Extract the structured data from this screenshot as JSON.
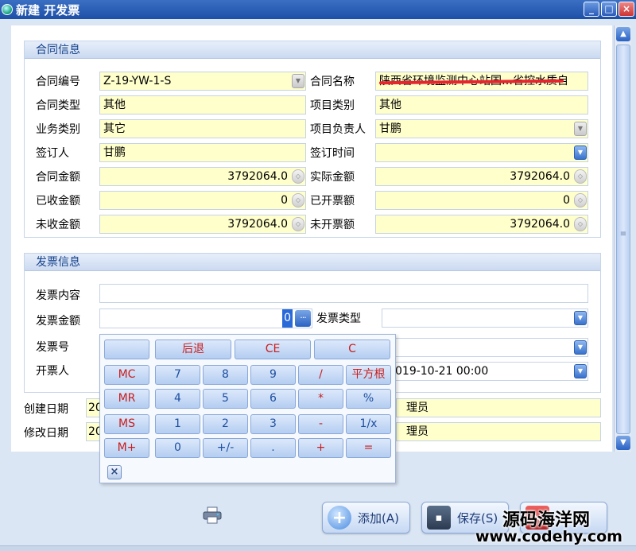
{
  "window": {
    "title": "新建 开发票",
    "min": "_",
    "max": "□",
    "close": "×"
  },
  "contract": {
    "section": "合同信息",
    "contract_no_label": "合同编号",
    "contract_no": "Z-19-YW-1-S",
    "contract_name_label": "合同名称",
    "contract_name": "陕西省环境监测中心站国…省控水质自",
    "contract_type_label": "合同类型",
    "contract_type": "其他",
    "project_type_label": "项目类别",
    "project_type": "其他",
    "business_type_label": "业务类别",
    "business_type": "其它",
    "project_lead_label": "项目负责人",
    "project_lead": "甘鹏",
    "signer_label": "签订人",
    "signer": "甘鹏",
    "sign_time_label": "签订时间",
    "sign_time": "",
    "amount_label": "合同金额",
    "amount": "3792064.0",
    "actual_label": "实际金额",
    "actual": "3792064.0",
    "received_label": "已收金额",
    "received": "0",
    "invoiced_label": "已开票额",
    "invoiced": "0",
    "unreceived_label": "未收金额",
    "unreceived": "3792064.0",
    "uninvoiced_label": "未开票额",
    "uninvoiced": "3792064.0"
  },
  "invoice": {
    "section": "发票信息",
    "content_label": "发票内容",
    "content": "",
    "amount_label": "发票金额",
    "amount": "0",
    "type_label": "发票类型",
    "type": "",
    "no_label": "发票号",
    "no": "",
    "issuer_label": "开票人",
    "issue_time": "019-10-21 00:00"
  },
  "meta": {
    "created_label": "创建日期",
    "created_prefix": "20",
    "created_by": "理员",
    "modified_label": "修改日期",
    "modified_prefix": "20",
    "modified_by": "理员"
  },
  "calculator": {
    "row1": [
      "",
      "后退",
      "CE",
      "C"
    ],
    "row2": [
      "MC",
      "7",
      "8",
      "9",
      "/",
      "平方根"
    ],
    "row3": [
      "MR",
      "4",
      "5",
      "6",
      "*",
      "%"
    ],
    "row4": [
      "MS",
      "1",
      "2",
      "3",
      "-",
      "1/x"
    ],
    "row5": [
      "M+",
      "0",
      "+/-",
      ".",
      "+",
      "="
    ],
    "close": "×"
  },
  "buttons": {
    "add": "添加(A)",
    "save": "保存(S)",
    "dots": "···"
  },
  "watermark": {
    "line1": "源码海洋网",
    "line2": "www.codehy.com"
  },
  "colors": {
    "field_bg": "#ffffcc",
    "title_bar": "#1d4fa6",
    "red_keys": "#c81e1e",
    "blue_keys": "#1e4fa0"
  }
}
